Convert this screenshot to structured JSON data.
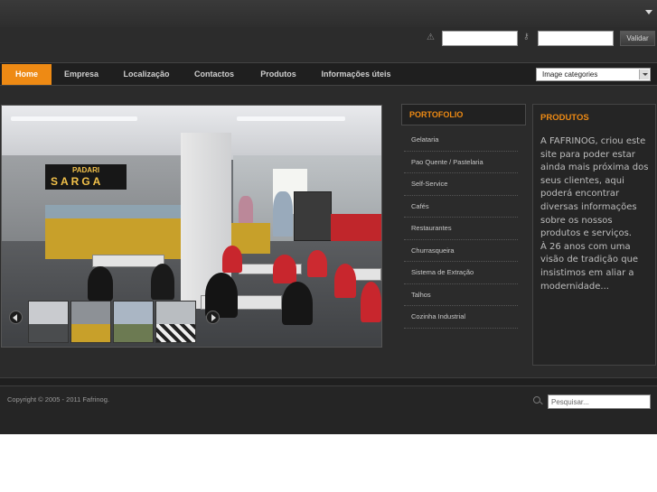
{
  "login": {
    "username_value": "",
    "password_value": "",
    "submit_label": "Validar",
    "user_icon": "warning-triangle-icon",
    "password_icon": "key-icon"
  },
  "nav": {
    "items": [
      {
        "label": "Home",
        "active": true
      },
      {
        "label": "Empresa",
        "active": false
      },
      {
        "label": "Localização",
        "active": false
      },
      {
        "label": "Contactos",
        "active": false
      },
      {
        "label": "Produtos",
        "active": false
      },
      {
        "label": "Informações úteis",
        "active": false
      }
    ],
    "category_select": "Image categories"
  },
  "slideshow": {
    "sign_text": [
      "PADARI",
      "SARGA"
    ]
  },
  "portfolio": {
    "title": "PORTOFOLIO",
    "items": [
      "Gelataria",
      "Pao Quente / Pastelaria",
      "Self-Service",
      "Cafés",
      "Restaurantes",
      "Churrasqueira",
      "Sistema de Extração",
      "Talhos",
      "Cozinha Industrial"
    ]
  },
  "produtos": {
    "title": "PRODUTOS",
    "text": "A FAFRINOG, criou este site para poder estar ainda mais próxima dos seus clientes, aqui poderá encontrar diversas informações sobre os nossos produtos e serviços.\nÀ 26 anos com uma visão de tradição que insistimos em aliar a modernidade..."
  },
  "footer": {
    "copyright": "Copyright © 2005 - 2011 Fafrinog.",
    "search_placeholder": "Pesquisar...",
    "search_value": ""
  },
  "colors": {
    "accent": "#ee8a14",
    "background": "#2b2b2b"
  }
}
